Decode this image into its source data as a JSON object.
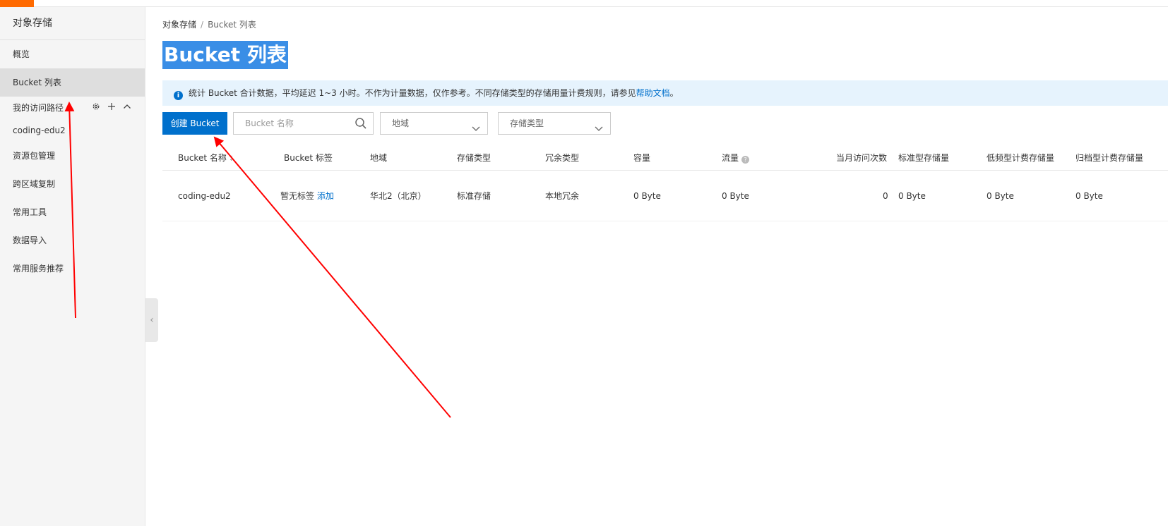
{
  "colors": {
    "accent": "#0070cc",
    "brand": "#ff6a00",
    "annotation": "#ff0000",
    "notice_bg": "#e6f3fd",
    "title_highlight": "#3a8ee6"
  },
  "sidebar": {
    "title": "对象存储",
    "items_top": [
      {
        "label": "概览",
        "active": false
      },
      {
        "label": "Bucket 列表",
        "active": true
      }
    ],
    "group": {
      "label": "我的访问路径",
      "icons": [
        "gear-icon",
        "plus-icon",
        "chevron-up-icon"
      ]
    },
    "group_items": [
      {
        "label": "coding-edu2"
      }
    ],
    "items_bottom": [
      {
        "label": "资源包管理"
      },
      {
        "label": "跨区域复制"
      },
      {
        "label": "常用工具"
      },
      {
        "label": "数据导入"
      },
      {
        "label": "常用服务推荐"
      }
    ]
  },
  "breadcrumb": {
    "root": "对象存储",
    "separator": "/",
    "current": "Bucket 列表"
  },
  "page_title": "Bucket 列表",
  "notice": {
    "text_before": "统计 Bucket 合计数据，平均延迟 1~3 小时。不作为计量数据，仅作参考。不同存储类型的存储用量计费规则，请参见",
    "link": "帮助文档",
    "text_after": "。"
  },
  "toolbar": {
    "create_label": "创建 Bucket",
    "search_placeholder": "Bucket 名称",
    "region_select": "地域",
    "storage_select": "存储类型"
  },
  "table": {
    "columns": [
      "Bucket 名称",
      "Bucket 标签",
      "地域",
      "存储类型",
      "冗余类型",
      "容量",
      "流量",
      "当月访问次数",
      "标准型存储量",
      "低频型计费存储量",
      "归档型计费存储量"
    ],
    "rows": [
      {
        "name": "coding-edu2",
        "tag_text": "暂无标签",
        "tag_link": "添加",
        "region": "华北2（北京）",
        "storage_type": "标准存储",
        "redundancy": "本地冗余",
        "capacity": "0 Byte",
        "traffic": "0 Byte",
        "monthly_visits": "0",
        "standard_storage": "0 Byte",
        "ia_storage": "0 Byte",
        "archive_storage": "0 Byte"
      }
    ]
  }
}
